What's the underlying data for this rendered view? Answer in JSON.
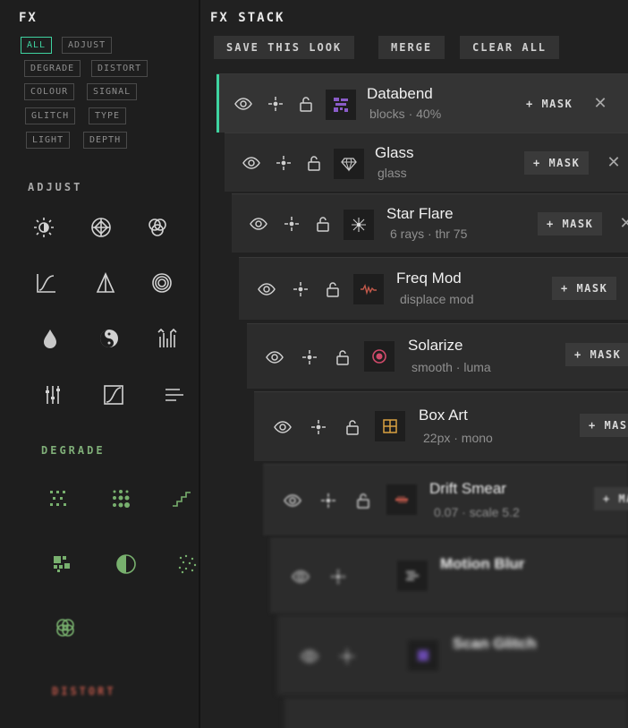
{
  "left_panel": {
    "title": "FX",
    "filter_chips": [
      {
        "label": "ALL",
        "active": true
      },
      {
        "label": "ADJUST",
        "active": false
      },
      {
        "label": "DEGRADE",
        "active": false
      },
      {
        "label": "DISTORT",
        "active": false
      },
      {
        "label": "COLOUR",
        "active": false
      },
      {
        "label": "SIGNAL",
        "active": false
      },
      {
        "label": "GLITCH",
        "active": false
      },
      {
        "label": "TYPE",
        "active": false
      },
      {
        "label": "LIGHT",
        "active": false
      },
      {
        "label": "DEPTH",
        "active": false
      }
    ],
    "sections": {
      "adjust": {
        "title": "ADJUST",
        "icons": [
          "brightness-icon",
          "crosshair-circle-icon",
          "rgb-circles-icon",
          "curve-icon",
          "triangle-icon",
          "concentric-circles-icon",
          "drop-icon",
          "yin-yang-icon",
          "levels-icon",
          "sliders-icon",
          "tone-curve-icon",
          "align-lines-icon"
        ]
      },
      "degrade": {
        "title": "DEGRADE",
        "icons": [
          "dither-grid-icon",
          "halftone-dots-icon",
          "staircase-icon",
          "pixel-blocks-icon",
          "half-circle-icon",
          "noise-dots-icon",
          "overlap-circles-icon"
        ]
      },
      "distort": {
        "title": "DISTORT"
      }
    }
  },
  "fx_stack": {
    "title": "FX STACK",
    "toolbar": {
      "save_label": "SAVE THIS LOOK",
      "merge_label": "MERGE",
      "clear_label": "CLEAR ALL"
    },
    "mask_label": "+ MASK",
    "close_glyph": "✕",
    "layers": [
      {
        "name": "Databend",
        "sub": "blocks · 40%",
        "thumb": "databend-thumb-icon",
        "selected": true
      },
      {
        "name": "Glass",
        "sub": "glass",
        "thumb": "gem-thumb-icon",
        "selected": false
      },
      {
        "name": "Star Flare",
        "sub": "6 rays · thr 75",
        "thumb": "starburst-thumb-icon",
        "selected": false
      },
      {
        "name": "Freq Mod",
        "sub": "displace mod",
        "thumb": "waveform-thumb-icon",
        "selected": false
      },
      {
        "name": "Solarize",
        "sub": "smooth · luma",
        "thumb": "target-thumb-icon",
        "selected": false
      },
      {
        "name": "Box Art",
        "sub": "22px · mono",
        "thumb": "grid-box-thumb-icon",
        "selected": false
      },
      {
        "name": "Drift Smear",
        "sub": "0.07 · scale 5.2",
        "thumb": "smear-thumb-icon",
        "selected": false
      },
      {
        "name": "Motion Blur",
        "sub": "",
        "thumb": "motion-blur-thumb-icon",
        "selected": false
      },
      {
        "name": "Scan Glitch",
        "sub": "",
        "thumb": "scan-glitch-thumb-icon",
        "selected": false
      }
    ]
  },
  "colors": {
    "accent": "#3fd3a0",
    "degrade": "#78b06e",
    "distort": "#c0584a",
    "databend_thumb": "#8a5cc8",
    "freqmod_thumb": "#c0584a",
    "solarize_thumb": "#d04a6a",
    "boxart_thumb": "#d8a040"
  }
}
